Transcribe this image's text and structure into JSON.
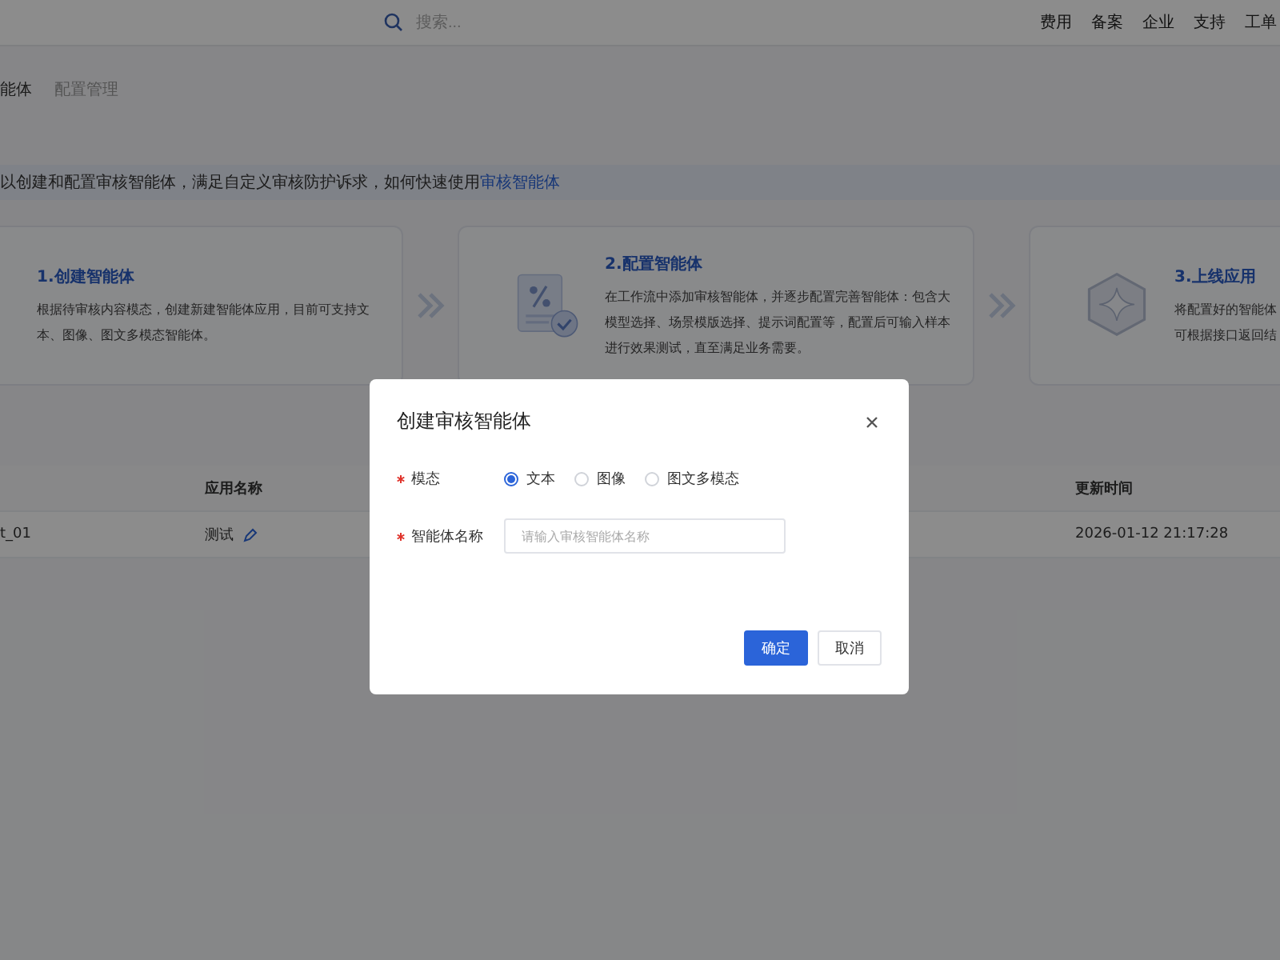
{
  "topbar": {
    "search": {
      "placeholder": "搜索..."
    },
    "links": [
      "费用",
      "备案",
      "企业",
      "支持",
      "工单"
    ]
  },
  "breadcrumb": [
    "能体",
    "配置管理"
  ],
  "banner": {
    "text": "以创建和配置审核智能体，满足自定义审核防护诉求，如何快速使用",
    "link": "审核智能体"
  },
  "steps": [
    {
      "kind": "text",
      "title": "1.创建智能体",
      "lines": [
        "根据待审核内容模态，创建新建智能体应用，目前可支持文",
        "本、图像、图文多模态智能体。"
      ]
    },
    {
      "kind": "document",
      "title": "2.配置智能体",
      "lines": [
        "在工作流中添加审核智能体，并逐步配置完善智能体：包含大",
        "模型选择、场景模版选择、提示词配置等，配置后可输入样本",
        "进行效果测试，直至满足业务需要。"
      ]
    },
    {
      "kind": "hexagon",
      "title": "3.上线应用",
      "lines": [
        "将配置好的智能体",
        "可根据接口返回结"
      ]
    }
  ],
  "table": {
    "columns": [
      "应用名称",
      "更新时间"
    ],
    "rows": [
      {
        "column_1": "t_01",
        "name": "测试",
        "updated": "2026-01-12 21:17:28"
      }
    ]
  },
  "dialog": {
    "title": "创建审核智能体",
    "fields": [
      {
        "kind": "radio",
        "label": "模态",
        "required": true,
        "options": [
          {
            "label": "文本",
            "selected": true
          },
          {
            "label": "图像",
            "selected": false
          },
          {
            "label": "图文多模态",
            "selected": false
          }
        ]
      },
      {
        "kind": "text",
        "label": "智能体名称",
        "required": true,
        "placeholder": "请输入审核智能体名称"
      }
    ],
    "buttons": [
      {
        "label": "确定",
        "primary": true
      },
      {
        "label": "取消",
        "primary": false
      }
    ]
  }
}
